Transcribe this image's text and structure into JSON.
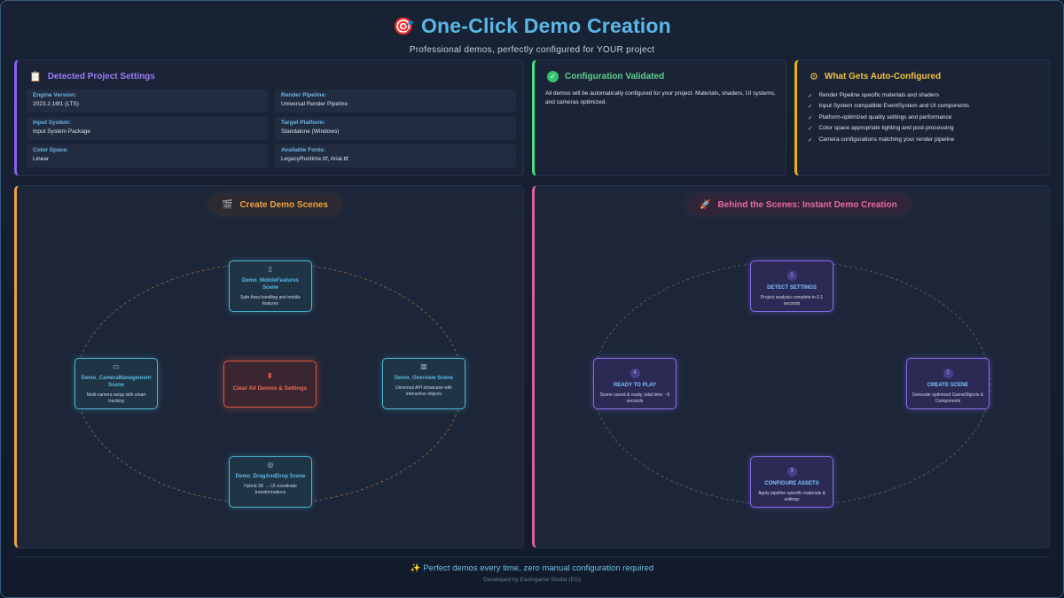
{
  "header": {
    "icon": "target-icon",
    "title": "One-Click Demo Creation",
    "subtitle": "Professional demos, perfectly configured for YOUR project"
  },
  "settings": {
    "title": "Detected Project Settings",
    "icon": "clipboard-icon",
    "items": [
      {
        "label": "Engine Version:",
        "value": "2023.2.16f1 (LTS)"
      },
      {
        "label": "Render Pipeline:",
        "value": "Universal Render Pipeline"
      },
      {
        "label": "Input System:",
        "value": "Input System Package"
      },
      {
        "label": "Target Platform:",
        "value": "Standalone (Windows)"
      },
      {
        "label": "Color Space:",
        "value": "Linear"
      },
      {
        "label": "Available Fonts:",
        "value": "LegacyRuntime.ttf, Arial.ttf"
      }
    ]
  },
  "validated": {
    "title": "Configuration Validated",
    "icon": "check-icon",
    "text": "All demos will be automatically configured for your project. Materials, shaders, UI systems, and cameras optimized."
  },
  "auto": {
    "title": "What Gets Auto-Configured",
    "icon": "gear-icon",
    "items": [
      "Render Pipeline specific materials and shaders",
      "Input System compatible EventSystem and UI components",
      "Platform-optimized quality settings and performance",
      "Color space appropriate lighting and post-processing",
      "Camera configurations matching your render pipeline"
    ]
  },
  "create": {
    "title": "Create Demo Scenes",
    "icon": "clapper-icon",
    "scenes": {
      "top": {
        "icon": "phone-icon",
        "title": "Demo_MobileFeatures Scene",
        "desc": "Safe Area handling and mobile features"
      },
      "left": {
        "icon": "camera-icon",
        "title": "Demo_CameraManagement Scene",
        "desc": "Multi-camera setup with smart tracking"
      },
      "right": {
        "icon": "chart-icon",
        "title": "Demo_Overview Scene",
        "desc": "Universal API showcase with interactive objects"
      },
      "bottom": {
        "icon": "target-icon",
        "title": "Demo_DragAndDrop Scene",
        "desc": "Hybrid 3D ↔ UI coordinate transformations"
      }
    },
    "clear": {
      "icon": "trash-icon",
      "label": "Clear All Demos & Settings"
    }
  },
  "behind": {
    "title": "Behind the Scenes: Instant Demo Creation",
    "icon": "rocket-icon",
    "steps": {
      "s1": {
        "num": "1",
        "title": "DETECT SETTINGS",
        "desc": "Project analysis complete in 0.1 seconds"
      },
      "s2": {
        "num": "2",
        "title": "CREATE SCENE",
        "desc": "Generate optimized GameObjects & Components"
      },
      "s3": {
        "num": "3",
        "title": "CONFIGURE ASSETS",
        "desc": "Apply pipeline-specific materials & settings"
      },
      "s4": {
        "num": "4",
        "title": "READY TO PLAY",
        "desc": "Scene saved & ready, total time: ~5 seconds"
      }
    }
  },
  "footer": {
    "icon": "sparkles-icon",
    "text": "Perfect demos every time, zero manual configuration required",
    "credit": "Developed by Easingame Studio (EG)"
  },
  "colors": {
    "accent_blue": "#5ab8e6",
    "settings_purple": "#8b5cf6",
    "valid_green": "#4ade80",
    "auto_yellow": "#eab308",
    "create_orange": "#f0a040",
    "behind_pink": "#e05f9a",
    "danger_red": "#e0533e"
  }
}
